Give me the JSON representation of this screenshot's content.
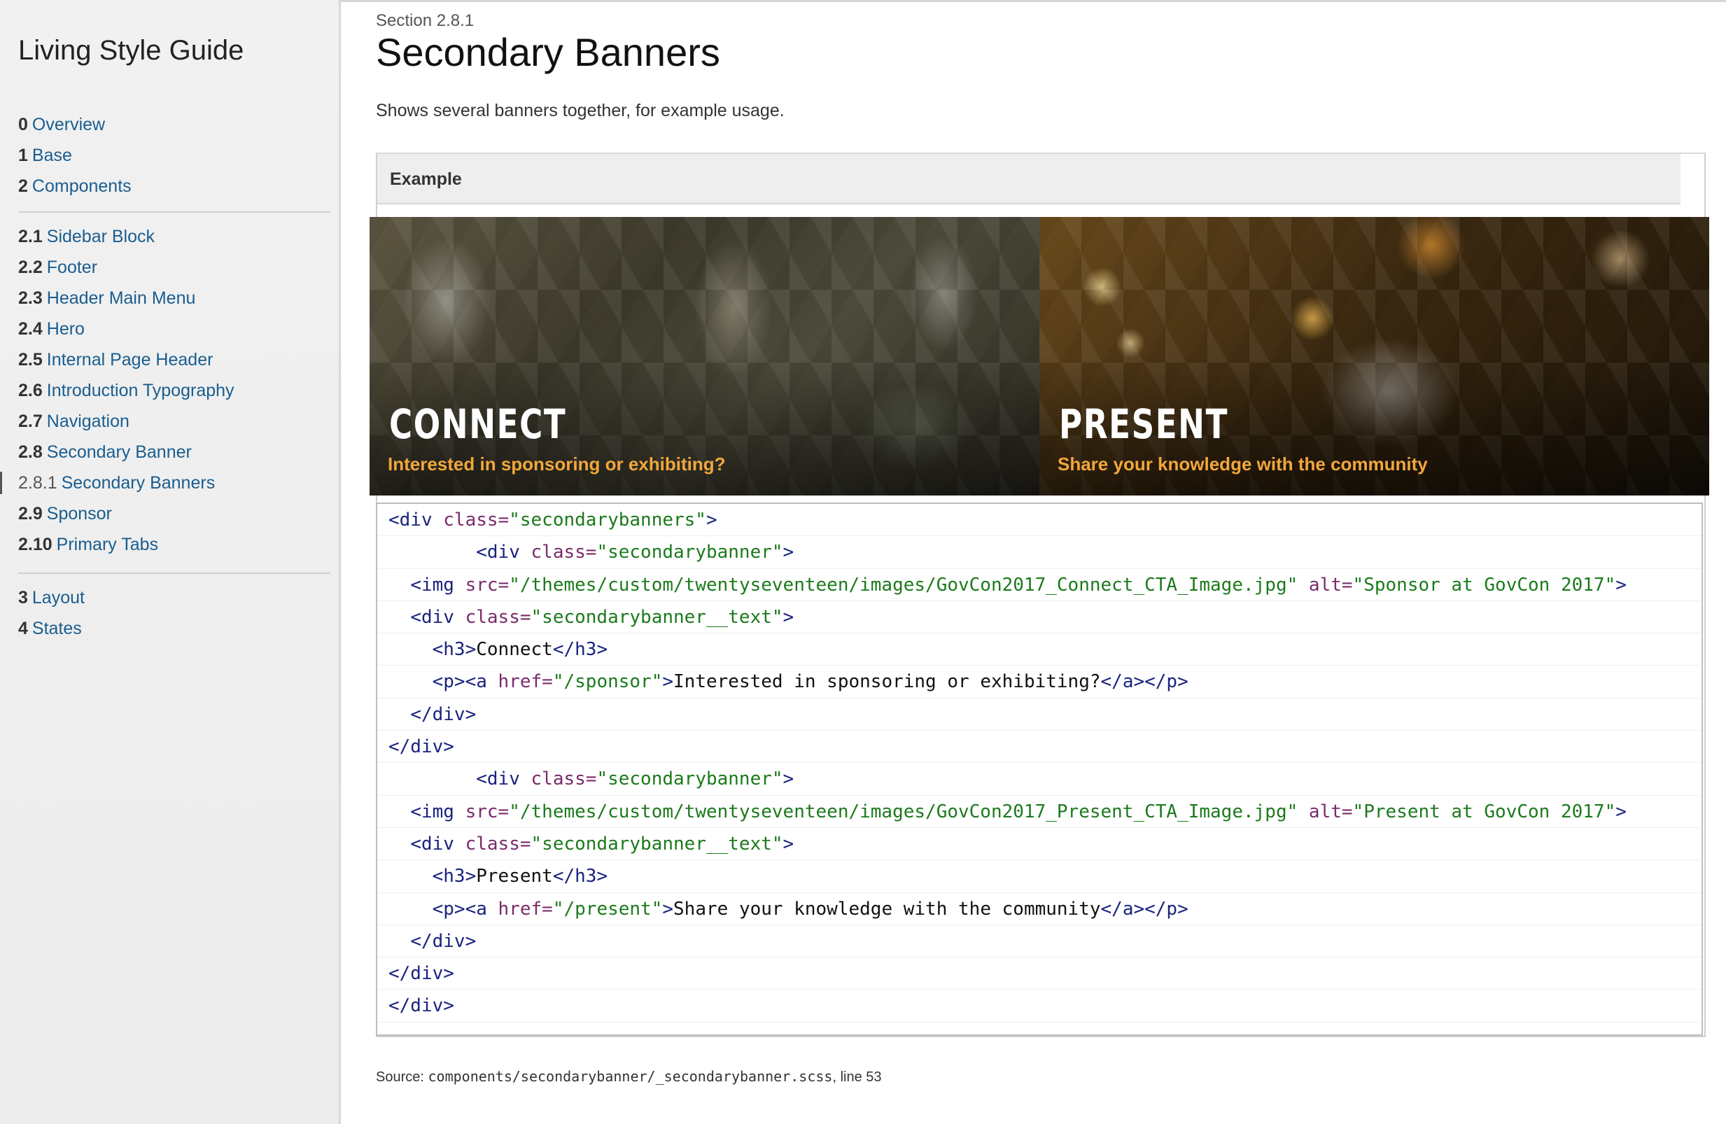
{
  "sidebar": {
    "title": "Living Style Guide",
    "top_items": [
      {
        "num": "0",
        "label": "Overview"
      },
      {
        "num": "1",
        "label": "Base"
      },
      {
        "num": "2",
        "label": "Components"
      }
    ],
    "component_items": [
      {
        "num": "2.1",
        "label": "Sidebar Block"
      },
      {
        "num": "2.2",
        "label": "Footer"
      },
      {
        "num": "2.3",
        "label": "Header Main Menu"
      },
      {
        "num": "2.4",
        "label": "Hero"
      },
      {
        "num": "2.5",
        "label": "Internal Page Header"
      },
      {
        "num": "2.6",
        "label": "Introduction Typography"
      },
      {
        "num": "2.7",
        "label": "Navigation"
      },
      {
        "num": "2.8",
        "label": "Secondary Banner"
      },
      {
        "num": "2.8.1",
        "label": "Secondary Banners"
      },
      {
        "num": "2.9",
        "label": "Sponsor"
      },
      {
        "num": "2.10",
        "label": "Primary Tabs"
      }
    ],
    "bottom_items": [
      {
        "num": "3",
        "label": "Layout"
      },
      {
        "num": "4",
        "label": "States"
      }
    ]
  },
  "main": {
    "section_ref": "Section 2.8.1",
    "title": "Secondary Banners",
    "description": "Shows several banners together, for example usage.",
    "example_label": "Example"
  },
  "banners": {
    "connect": {
      "title": "CONNECT",
      "subtitle": "Interested in sponsoring or exhibiting?"
    },
    "present": {
      "title": "PRESENT",
      "subtitle": "Share your knowledge with the community"
    }
  },
  "code": {
    "l1": {
      "indent": "",
      "t1": "<div ",
      "a1": "class=",
      "s1": "\"secondarybanners\"",
      "t2": ">"
    },
    "l2": {
      "indent": "        ",
      "t1": "<div ",
      "a1": "class=",
      "s1": "\"secondarybanner\"",
      "t2": ">"
    },
    "l3": {
      "indent": "  ",
      "t1": "<img ",
      "a1": "src=",
      "s1": "\"/themes/custom/twentyseventeen/images/GovCon2017_Connect_CTA_Image.jpg\"",
      "a2": " alt=",
      "s2": "\"Sponsor at GovCon 2017\"",
      "t2": ">"
    },
    "l4": {
      "indent": "  ",
      "t1": "<div ",
      "a1": "class=",
      "s1": "\"secondarybanner__text\"",
      "t2": ">"
    },
    "l5": {
      "indent": "    ",
      "t1": "<h3>",
      "x1": "Connect",
      "t2": "</h3>"
    },
    "l6": {
      "indent": "    ",
      "t1": "<p><a ",
      "a1": "href=",
      "s1": "\"/sponsor\"",
      "t2": ">",
      "x1": "Interested in sponsoring or exhibiting?",
      "t3": "</a></p>"
    },
    "l7": {
      "indent": "  ",
      "t1": "</div>"
    },
    "l8": {
      "indent": "",
      "t1": "</div>"
    },
    "l9": {
      "indent": "        ",
      "t1": "<div ",
      "a1": "class=",
      "s1": "\"secondarybanner\"",
      "t2": ">"
    },
    "l10": {
      "indent": "  ",
      "t1": "<img ",
      "a1": "src=",
      "s1": "\"/themes/custom/twentyseventeen/images/GovCon2017_Present_CTA_Image.jpg\"",
      "a2": " alt=",
      "s2": "\"Present at GovCon 2017\"",
      "t2": ">"
    },
    "l11": {
      "indent": "  ",
      "t1": "<div ",
      "a1": "class=",
      "s1": "\"secondarybanner__text\"",
      "t2": ">"
    },
    "l12": {
      "indent": "    ",
      "t1": "<h3>",
      "x1": "Present",
      "t2": "</h3>"
    },
    "l13": {
      "indent": "    ",
      "t1": "<p><a ",
      "a1": "href=",
      "s1": "\"/present\"",
      "t2": ">",
      "x1": "Share your knowledge with the community",
      "t3": "</a></p>"
    },
    "l14": {
      "indent": "  ",
      "t1": "</div>"
    },
    "l15": {
      "indent": "",
      "t1": "</div>"
    },
    "l16": {
      "indent": "",
      "t1": "</div>"
    }
  },
  "source": {
    "label": "Source: ",
    "path": "components/secondarybanner/_secondarybanner.scss",
    "line": ", line 53"
  }
}
